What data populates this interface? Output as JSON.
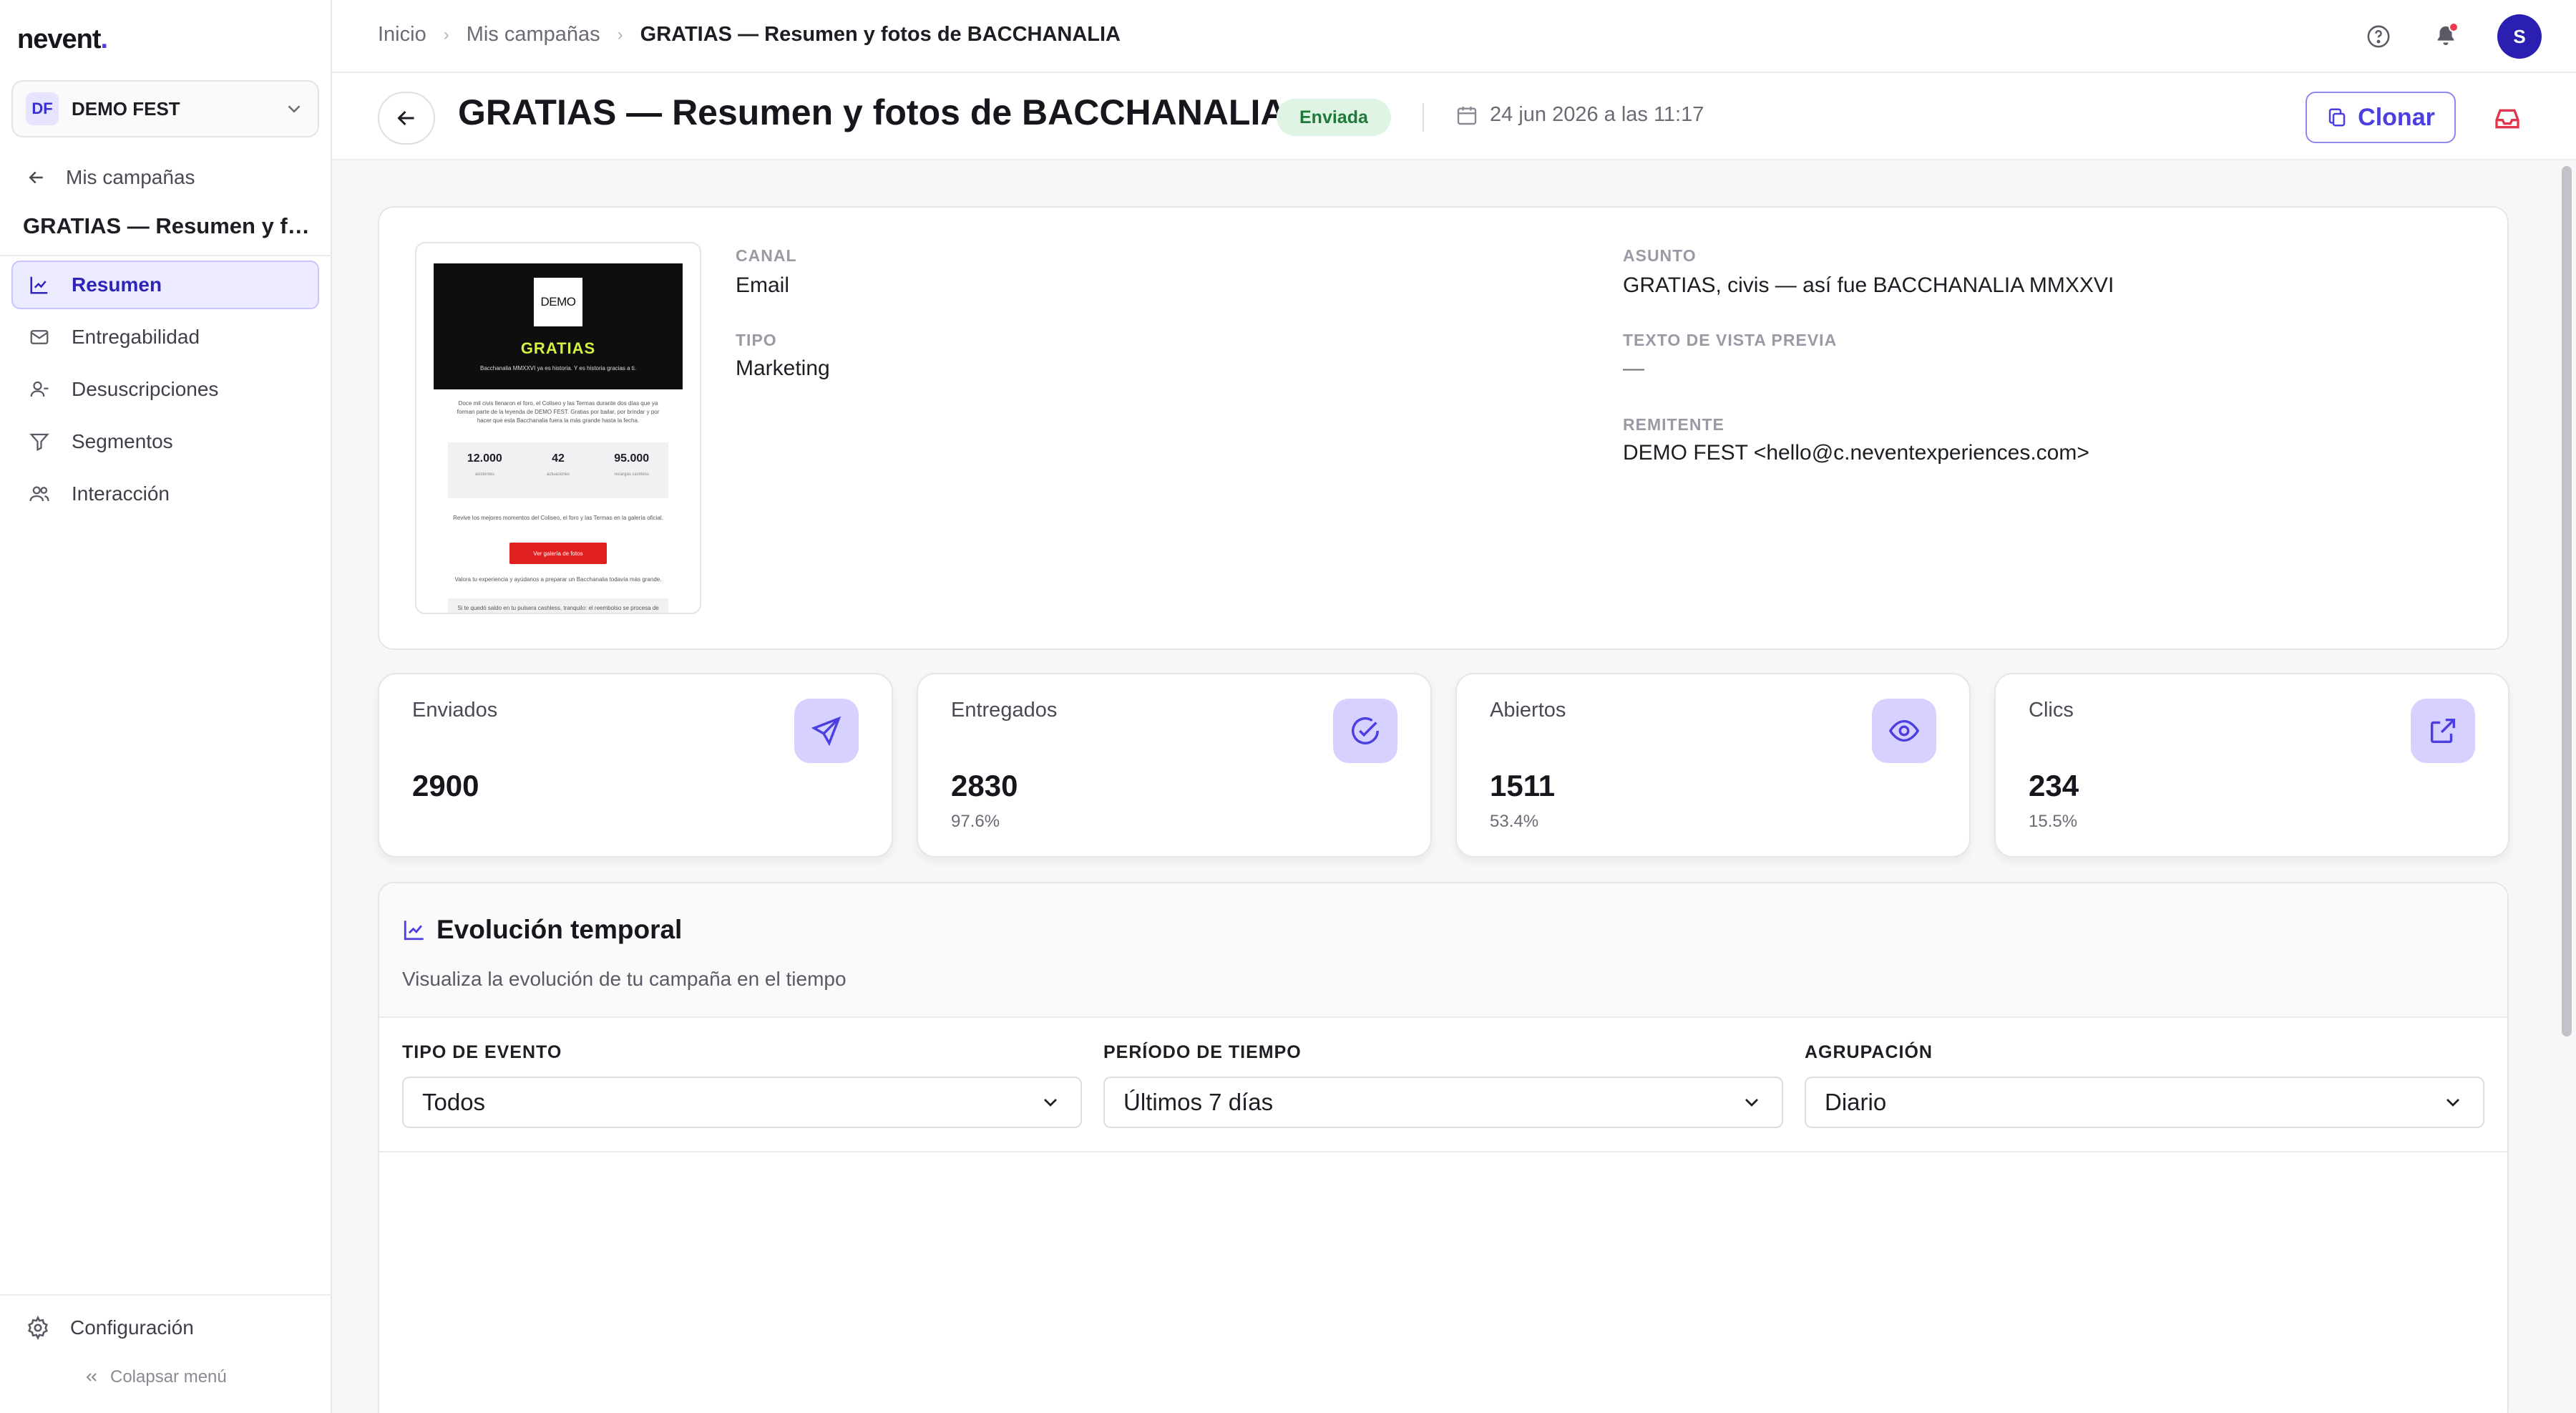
{
  "app": {
    "logo_text": "nevent",
    "logo_dot": "."
  },
  "org": {
    "initials": "DF",
    "name": "DEMO FEST"
  },
  "sidebar": {
    "back_label": "Mis campañas",
    "campaign_title": "GRATIAS — Resumen y fotos de BACCHANALIA",
    "items": [
      {
        "label": "Resumen",
        "icon": "chart-line-icon",
        "active": true
      },
      {
        "label": "Entregabilidad",
        "icon": "mail-icon",
        "active": false
      },
      {
        "label": "Desuscripciones",
        "icon": "user-minus-icon",
        "active": false
      },
      {
        "label": "Segmentos",
        "icon": "filter-icon",
        "active": false
      },
      {
        "label": "Interacción",
        "icon": "users-icon",
        "active": false
      }
    ],
    "settings_label": "Configuración",
    "collapse_label": "Colapsar menú"
  },
  "breadcrumb": {
    "home": "Inicio",
    "section": "Mis campañas",
    "current": "GRATIAS — Resumen y fotos de BACCHANALIA"
  },
  "user": {
    "initial": "S"
  },
  "header": {
    "title": "GRATIAS — Resumen y fotos de BACCHANALIA",
    "status": "Enviada",
    "date": "24 jun 2026 a las 11:17",
    "clone_label": "Clonar"
  },
  "info": {
    "channel_label": "CANAL",
    "channel_value": "Email",
    "type_label": "TIPO",
    "type_value": "Marketing",
    "subject_label": "ASUNTO",
    "subject_value": "GRATIAS, civis — así fue BACCHANALIA MMXXVI",
    "preview_label": "TEXTO DE VISTA PREVIA",
    "preview_value": "—",
    "sender_label": "REMITENTE",
    "sender_value": "DEMO FEST <hello@c.neventexperiences.com>"
  },
  "email_preview": {
    "logo": "DEMO",
    "heading": "GRATIAS",
    "subheading": "Bacchanalia MMXXVI ya es historia. Y es historia gracias a ti.",
    "intro": "Doce mil civis llenaron el foro, el Coliseo y las Termas durante dos días que ya forman parte de la leyenda de DEMO FEST. Gratias por bailar, por brindar y por hacer que esta Bacchanalia fuera la más grande hasta la fecha.",
    "stats": [
      {
        "value": "12.000",
        "label": "asistentes"
      },
      {
        "value": "42",
        "label": "actuaciones"
      },
      {
        "value": "95.000",
        "label": "recargas cashless"
      }
    ],
    "gallery_text": "Revive los mejores momentos del Coliseo, el foro y las Termas en la galería oficial.",
    "cta": "Ver galería de fotos",
    "survey_text": "Valora tu experiencia y ayúdanos a preparar un Bacchanalia todavía más grande.",
    "cashless_text": "Si te quedó saldo en tu pulsera cashless, tranquilo: el reembolso se procesa de forma automática en un plazo de quince días, sin que tengas que hacer nada."
  },
  "stats": [
    {
      "label": "Enviados",
      "value": "2900",
      "pct": "",
      "icon": "send-icon"
    },
    {
      "label": "Entregados",
      "value": "2830",
      "pct": "97.6%",
      "icon": "check-circle-icon"
    },
    {
      "label": "Abiertos",
      "value": "1511",
      "pct": "53.4%",
      "icon": "eye-icon"
    },
    {
      "label": "Clics",
      "value": "234",
      "pct": "15.5%",
      "icon": "external-link-icon"
    }
  ],
  "chart_section": {
    "title": "Evolución temporal",
    "subtitle": "Visualiza la evolución de tu campaña en el tiempo",
    "filters": [
      {
        "label": "TIPO DE EVENTO",
        "value": "Todos"
      },
      {
        "label": "PERÍODO DE TIEMPO",
        "value": "Últimos 7 días"
      },
      {
        "label": "AGRUPACIÓN",
        "value": "Diario"
      }
    ]
  },
  "colors": {
    "accent": "#4b3fe0",
    "active_nav_bg": "#ecebff",
    "status_bg": "#dff4e4",
    "status_text": "#1f7a3a",
    "stat_icon_bg": "#d6d1ff",
    "notification": "#ef3b4f",
    "avatar": "#2a1fb0"
  }
}
